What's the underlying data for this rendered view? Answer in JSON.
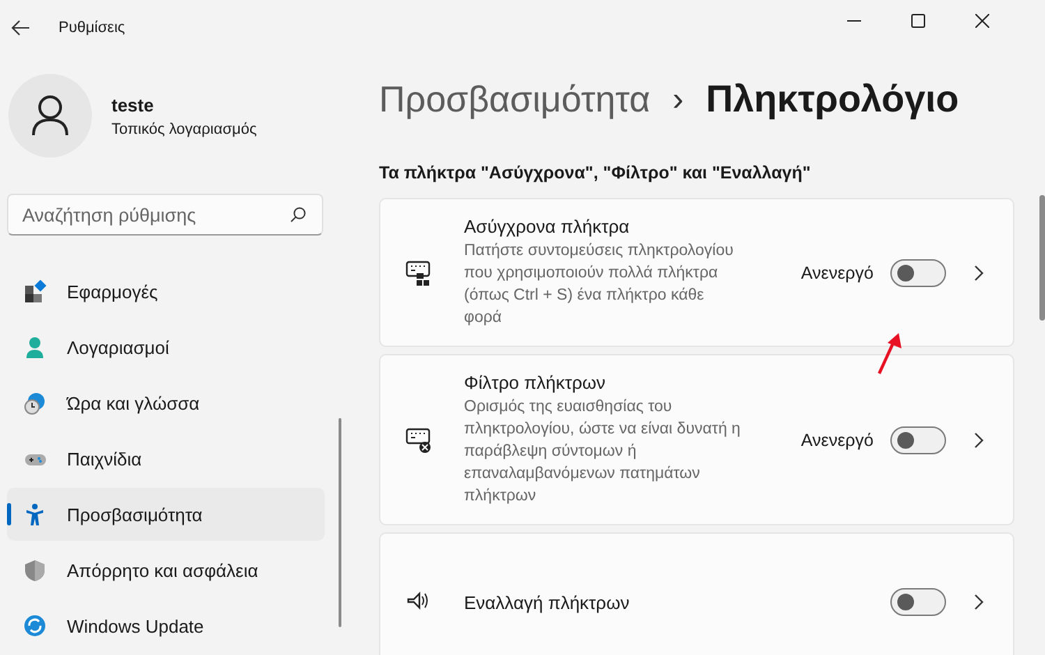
{
  "window": {
    "title": "Ρυθμίσεις"
  },
  "user": {
    "name": "teste",
    "account": "Τοπικός λογαριασμός"
  },
  "search": {
    "placeholder": "Αναζήτηση ρύθμισης"
  },
  "sidebar": {
    "items": [
      {
        "label": "Εφαρμογές",
        "selected": false
      },
      {
        "label": "Λογαριασμοί",
        "selected": false
      },
      {
        "label": "Ώρα και γλώσσα",
        "selected": false
      },
      {
        "label": "Παιχνίδια",
        "selected": false
      },
      {
        "label": "Προσβασιμότητα",
        "selected": true
      },
      {
        "label": "Απόρρητο και ασφάλεια",
        "selected": false
      },
      {
        "label": "Windows Update",
        "selected": false
      }
    ]
  },
  "breadcrumb": {
    "parent": "Προσβασιμότητα",
    "separator": "›",
    "current": "Πληκτρολόγιο"
  },
  "section": {
    "heading": "Τα πλήκτρα \"Ασύγχρονα\", \"Φίλτρο\" και \"Εναλλαγή\""
  },
  "cards": [
    {
      "title": "Ασύγχρονα πλήκτρα",
      "description": "Πατήστε συντομεύσεις πληκτρολογίου που χρησιμοποιούν πολλά πλήκτρα (όπως Ctrl + S) ένα πλήκτρο κάθε φορά",
      "state_text": "Ανενεργό",
      "on": false
    },
    {
      "title": "Φίλτρο πλήκτρων",
      "description": "Ορισμός της ευαισθησίας του πληκτρολογίου, ώστε να είναι δυνατή η παράβλεψη σύντομων ή επαναλαμβανόμενων πατημάτων πλήκτρων",
      "state_text": "Ανενεργό",
      "on": false
    },
    {
      "title": "Εναλλαγή πλήκτρων",
      "on": false
    }
  ]
}
